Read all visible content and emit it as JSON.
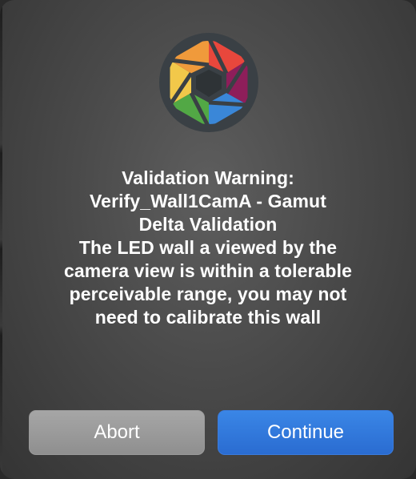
{
  "dialog": {
    "logo": "camera-aperture-logo",
    "title_lines": [
      "Validation Warning:",
      "Verify_Wall1CamA - Gamut",
      "Delta Validation"
    ],
    "body_lines": [
      "The LED wall a viewed by the",
      "camera view is within a tolerable",
      "perceivable range, you may not",
      "need to calibrate this wall"
    ],
    "buttons": {
      "abort_label": "Abort",
      "continue_label": "Continue"
    }
  },
  "colors": {
    "dialog_bg": "#4a4a4a",
    "primary_button": "#2f74da",
    "secondary_button": "#999999",
    "aperture_red": "#e8473c",
    "aperture_purple": "#8e1e5a",
    "aperture_blue": "#3a87d8",
    "aperture_green": "#52a845",
    "aperture_yellow": "#f2c84a",
    "aperture_orange": "#f09a3b"
  }
}
